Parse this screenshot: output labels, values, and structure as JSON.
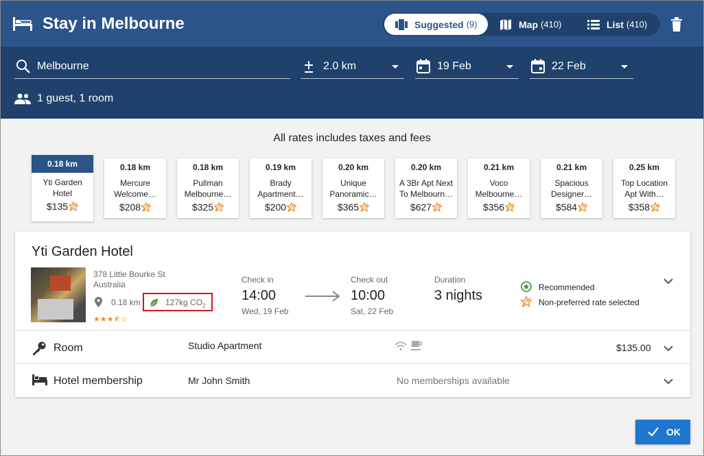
{
  "header": {
    "title": "Stay in Melbourne",
    "view_tabs": [
      {
        "label": "Suggested",
        "count": "(9)",
        "icon": "bar-chart-icon"
      },
      {
        "label": "Map",
        "count": "(410)",
        "icon": "map-icon"
      },
      {
        "label": "List",
        "count": "(410)",
        "icon": "list-icon"
      }
    ],
    "trash_icon": "trash-icon"
  },
  "search": {
    "location": "Melbourne",
    "radius": "2.0 km",
    "check_in": "19 Feb",
    "check_out": "22 Feb",
    "guests": "1 guest, 1 room"
  },
  "rates_note": "All rates includes taxes and fees",
  "hotel_cards": [
    {
      "distance": "0.18 km",
      "name_line1": "Yti Garden",
      "name_line2": "Hotel",
      "price": "$135",
      "selected": true
    },
    {
      "distance": "0.18 km",
      "name_line1": "Mercure",
      "name_line2": "Welcome…",
      "price": "$208",
      "selected": false
    },
    {
      "distance": "0.18 km",
      "name_line1": "Pullman",
      "name_line2": "Melbourne…",
      "price": "$325",
      "selected": false
    },
    {
      "distance": "0.19 km",
      "name_line1": "Brady",
      "name_line2": "Apartment…",
      "price": "$200",
      "selected": false
    },
    {
      "distance": "0.20 km",
      "name_line1": "Unique",
      "name_line2": "Panoramic…",
      "price": "$365",
      "selected": false
    },
    {
      "distance": "0.20 km",
      "name_line1": "A 3Br Apt Next",
      "name_line2": "To Melbourn…",
      "price": "$627",
      "selected": false
    },
    {
      "distance": "0.21 km",
      "name_line1": "Voco",
      "name_line2": "Melbourne…",
      "price": "$356",
      "selected": false
    },
    {
      "distance": "0.21 km",
      "name_line1": "Spacious",
      "name_line2": "Designer…",
      "price": "$584",
      "selected": false
    },
    {
      "distance": "0.25 km",
      "name_line1": "Top Location",
      "name_line2": "Apt With…",
      "price": "$358",
      "selected": false
    }
  ],
  "detail": {
    "hotel_name": "Yti Garden Hotel",
    "address_line1": "378 Little Bourke St",
    "address_line2": "Australia",
    "distance": "0.18 km",
    "co2": "127kg CO",
    "co2_sub": "2",
    "star_rating": 3.5,
    "stars_display": "★★★⯪☆",
    "check_in_label": "Check in",
    "check_in_time": "14:00",
    "check_in_date": "Wed, 19 Feb",
    "check_out_label": "Check out",
    "check_out_time": "10:00",
    "check_out_date": "Sat, 22 Feb",
    "duration_label": "Duration",
    "duration_value": "3 nights",
    "badges": [
      {
        "label": "Recommended",
        "icon": "recommended-star-icon"
      },
      {
        "label": "Non-preferred rate selected",
        "icon": "non-preferred-star-icon"
      }
    ]
  },
  "room": {
    "title": "Room",
    "value": "Studio Apartment",
    "amenities": [
      "wifi-icon",
      "coffee-icon"
    ],
    "price": "$135.00"
  },
  "membership": {
    "title": "Hotel membership",
    "value": "Mr John Smith",
    "note": "No memberships available"
  },
  "ok_label": "OK",
  "colors": {
    "header": "#2b5488",
    "searchbar": "#1f416c",
    "accent_star": "#f08a1c",
    "recommended": "#3a8a3a",
    "co2_border": "#d0161b",
    "ok_button": "#1e76cf"
  }
}
